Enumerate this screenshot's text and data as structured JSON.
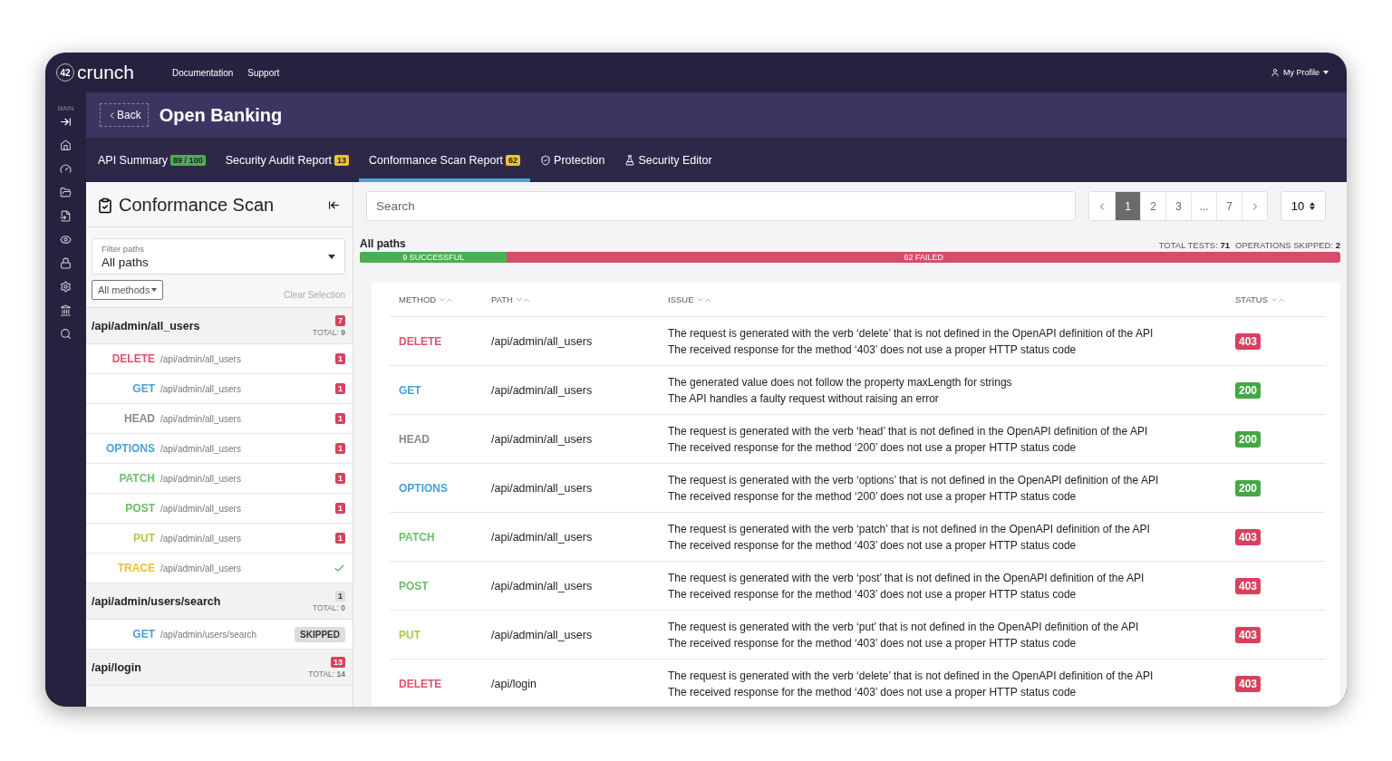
{
  "topbar": {
    "logo": "crunch",
    "logo_mark": "42",
    "links": [
      "Documentation",
      "Support"
    ],
    "profile": "My Profile"
  },
  "rail": {
    "label": "MAIN"
  },
  "header": {
    "back": "Back",
    "title": "Open Banking"
  },
  "tabs": [
    {
      "label": "API Summary",
      "badge": {
        "label": "89 / 100",
        "color": "#4caf50"
      },
      "selected": false
    },
    {
      "label": "Security Audit Report",
      "badge": {
        "label": "13",
        "color": "#f2c12e"
      },
      "selected": false
    },
    {
      "label": "Conformance Scan Report",
      "badge": {
        "label": "62",
        "color": "#f2c12e"
      },
      "selected": true
    },
    {
      "label": "Protection",
      "selected": false
    },
    {
      "label": "Security Editor",
      "selected": false
    }
  ],
  "sidebar": {
    "title": "Conformance Scan",
    "filter": {
      "label": "Filter paths",
      "value": "All paths"
    },
    "methods_button": "All methods",
    "clear": "Clear Selection",
    "groups": [
      {
        "path": "/api/admin/all_users",
        "count": {
          "label": "7",
          "color": "#d9405e"
        },
        "total_label": "TOTAL:",
        "total": "9",
        "items": [
          {
            "method": "DELETE",
            "color": "#e0506b",
            "path": "/api/admin/all_users",
            "kind": "count",
            "value": "1"
          },
          {
            "method": "GET",
            "color": "#4a9fd8",
            "path": "/api/admin/all_users",
            "kind": "count",
            "value": "1"
          },
          {
            "method": "HEAD",
            "color": "#8a8a8a",
            "path": "/api/admin/all_users",
            "kind": "count",
            "value": "1"
          },
          {
            "method": "OPTIONS",
            "color": "#4a9fd8",
            "path": "/api/admin/all_users",
            "kind": "count",
            "value": "1"
          },
          {
            "method": "PATCH",
            "color": "#6cbf6c",
            "path": "/api/admin/all_users",
            "kind": "count",
            "value": "1"
          },
          {
            "method": "POST",
            "color": "#6cbf6c",
            "path": "/api/admin/all_users",
            "kind": "count",
            "value": "1"
          },
          {
            "method": "PUT",
            "color": "#a8cc4a",
            "path": "/api/admin/all_users",
            "kind": "count",
            "value": "1"
          },
          {
            "method": "TRACE",
            "color": "#f0c030",
            "path": "/api/admin/all_users",
            "kind": "check"
          }
        ]
      },
      {
        "path": "/api/admin/users/search",
        "count": {
          "label": "1",
          "color": "#dddddd"
        },
        "total_label": "TOTAL:",
        "total": "0",
        "items": [
          {
            "method": "GET",
            "color": "#4a9fd8",
            "path": "/api/admin/users/search",
            "kind": "skipped",
            "value": "SKIPPED"
          }
        ]
      },
      {
        "path": "/api/login",
        "count": {
          "label": "13",
          "color": "#d9405e"
        },
        "total_label": "TOTAL:",
        "total": "14"
      }
    ]
  },
  "search": {
    "placeholder": "Search"
  },
  "pagination": [
    {
      "label": "1",
      "selected": true
    },
    {
      "label": "2",
      "selected": false
    },
    {
      "label": "3",
      "selected": false
    },
    {
      "label": "...",
      "selected": false
    },
    {
      "label": "7",
      "selected": false
    }
  ],
  "page_size": "10",
  "summary": {
    "title": "All paths",
    "total_label": "TOTAL TESTS:",
    "total": "71",
    "skipped_label": "OPERATIONS SKIPPED:",
    "skipped": "2",
    "success": "9 SUCCESSFUL",
    "failed": "62 FAILED",
    "level": 0.15
  },
  "table": {
    "columns": [
      "METHOD",
      "PATH",
      "ISSUE",
      "STATUS"
    ],
    "rows": [
      {
        "method": "DELETE",
        "color": "#e0506b",
        "path": "/api/admin/all_users",
        "issues": [
          "The request is generated with the verb ‘delete’ that is not defined in the OpenAPI definition of the API",
          "The received response for the method ‘403’ does not use a proper HTTP status code"
        ],
        "status": {
          "label": "403",
          "color": "#d9405e"
        }
      },
      {
        "method": "GET",
        "color": "#4a9fd8",
        "path": "/api/admin/all_users",
        "issues": [
          "The generated value does not follow the property maxLength for strings",
          "The API handles a faulty request without raising an error"
        ],
        "status": {
          "label": "200",
          "color": "#45a845"
        }
      },
      {
        "method": "HEAD",
        "color": "#8a8a8a",
        "path": "/api/admin/all_users",
        "issues": [
          "The request is generated with the verb ‘head’ that is not defined in the OpenAPI definition of the API",
          "The received response for the method ‘200’ does not use a proper HTTP status code"
        ],
        "status": {
          "label": "200",
          "color": "#45a845"
        }
      },
      {
        "method": "OPTIONS",
        "color": "#4a9fd8",
        "path": "/api/admin/all_users",
        "issues": [
          "The request is generated with the verb ‘options’ that is not defined in the OpenAPI definition of the API",
          "The received response for the method ‘200’ does not use a proper HTTP status code"
        ],
        "status": {
          "label": "200",
          "color": "#45a845"
        }
      },
      {
        "method": "PATCH",
        "color": "#6cbf6c",
        "path": "/api/admin/all_users",
        "issues": [
          "The request is generated with the verb ‘patch’ that is not defined in the OpenAPI definition of the API",
          "The received response for the method ‘403’ does not use a proper HTTP status code"
        ],
        "status": {
          "label": "403",
          "color": "#d9405e"
        }
      },
      {
        "method": "POST",
        "color": "#6cbf6c",
        "path": "/api/admin/all_users",
        "issues": [
          "The request is generated with the verb ‘post’ that is not defined in the OpenAPI definition of the API",
          "The received response for the method ‘403’ does not use a proper HTTP status code"
        ],
        "status": {
          "label": "403",
          "color": "#d9405e"
        }
      },
      {
        "method": "PUT",
        "color": "#a8cc4a",
        "path": "/api/admin/all_users",
        "issues": [
          "The request is generated with the verb ‘put’ that is not defined in the OpenAPI definition of the API",
          "The received response for the method ‘403’ does not use a proper HTTP status code"
        ],
        "status": {
          "label": "403",
          "color": "#d9405e"
        }
      },
      {
        "method": "DELETE",
        "color": "#e0506b",
        "path": "/api/login",
        "issues": [
          "The request is generated with the verb ‘delete’ that is not defined in the OpenAPI definition of the API",
          "The received response for the method ‘403’ does not use a proper HTTP status code"
        ],
        "status": {
          "label": "403",
          "color": "#d9405e"
        }
      }
    ]
  }
}
